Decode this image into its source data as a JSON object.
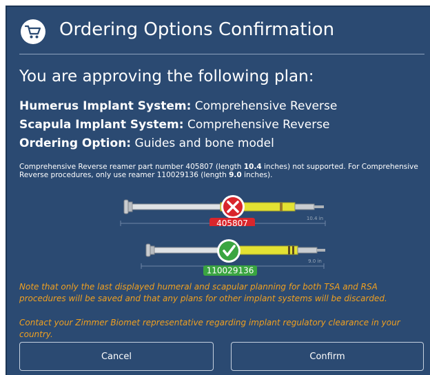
{
  "dialog": {
    "title": "Ordering Options Confirmation",
    "icon": "cart-icon",
    "subtitle": "You are approving the following plan:",
    "plan": [
      {
        "label": "Humerus Implant System:",
        "value": "Comprehensive Reverse"
      },
      {
        "label": "Scapula Implant System:",
        "value": "Comprehensive Reverse"
      },
      {
        "label": "Ordering Option:",
        "value": "Guides and bone model"
      }
    ],
    "note": {
      "part1": "Comprehensive Reverse reamer part number 405807 (length ",
      "bad_length": "10.4",
      "part2": " inches) not supported. For Comprehensive Reverse procedures, only use reamer 110029136 (length ",
      "good_length": "9.0",
      "part3": " inches)."
    },
    "reamers": [
      {
        "part_number": "405807",
        "length_label": "10.4 in",
        "status": "not-supported",
        "badge_color": "#d9262c"
      },
      {
        "part_number": "110029136",
        "length_label": "9.0 in",
        "status": "supported",
        "badge_color": "#3aa541"
      }
    ],
    "warning_1": "Note that only the last displayed humeral and scapular planning for both TSA and RSA procedures will be saved and that any plans for other implant systems will be discarded.",
    "warning_2": "Contact your Zimmer Biomet representative regarding implant regulatory clearance in your country.",
    "buttons": {
      "cancel": "Cancel",
      "confirm": "Confirm"
    },
    "colors": {
      "background": "#2b4a72",
      "warning": "#f0a020",
      "error": "#d9262c",
      "success": "#3aa541",
      "shaft_yellow": "#e3e233"
    }
  }
}
